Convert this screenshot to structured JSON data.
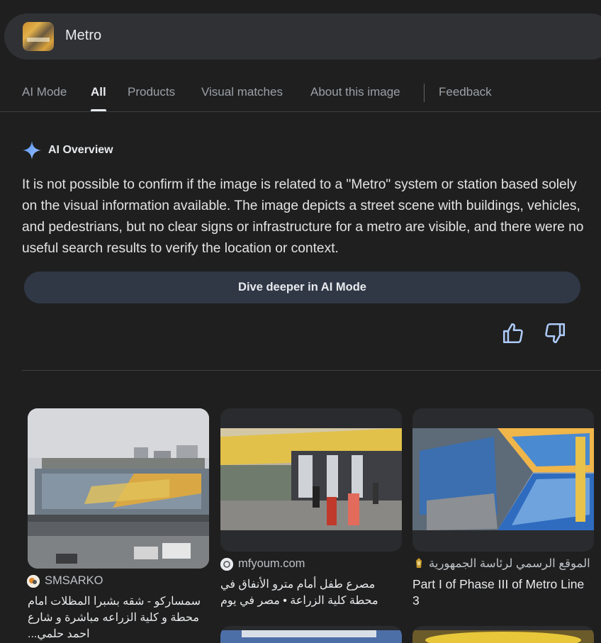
{
  "search": {
    "query": "Metro"
  },
  "tabs": [
    {
      "label": "AI Mode",
      "active": false
    },
    {
      "label": "All",
      "active": true
    },
    {
      "label": "Products",
      "active": false
    },
    {
      "label": "Visual matches",
      "active": false
    },
    {
      "label": "About this image",
      "active": false
    },
    {
      "label": "Feedback",
      "active": false
    }
  ],
  "ai_overview": {
    "title": "AI Overview",
    "text": "It is not possible to confirm if the image is related to a \"Metro\" system or station based solely on the visual information available. The image depicts a street scene with buildings, vehicles, and pedestrians, but no clear signs or infrastructure for a metro are visible, and there were no useful search results to verify the location or context.",
    "dive_button": "Dive deeper in AI Mode",
    "icons": {
      "sparkle": "sparkle-icon",
      "like": "thumb-up-icon",
      "dislike": "thumb-down-icon"
    }
  },
  "results": [
    {
      "source": "SMSARKO",
      "caption": "سمساركو - شقه بشبرا المظلات امام محطة و كلية الزراعه مباشرة و شارع احمد حلمي...",
      "rtl": true
    },
    {
      "source": "mfyoum.com",
      "caption": "مصرع طفل أمام مترو الأنفاق في محطة كلية الزراعة • مصر في يوم",
      "rtl": true
    },
    {
      "source": "الموقع الرسمي لرئاسة الجمهورية",
      "caption": "Part I of Phase III of Metro Line 3",
      "rtl": false
    }
  ],
  "colors": {
    "background": "#1f1f1f",
    "search_bg": "#303134",
    "button_bg": "#303846",
    "accent": "#8ab4f8"
  }
}
